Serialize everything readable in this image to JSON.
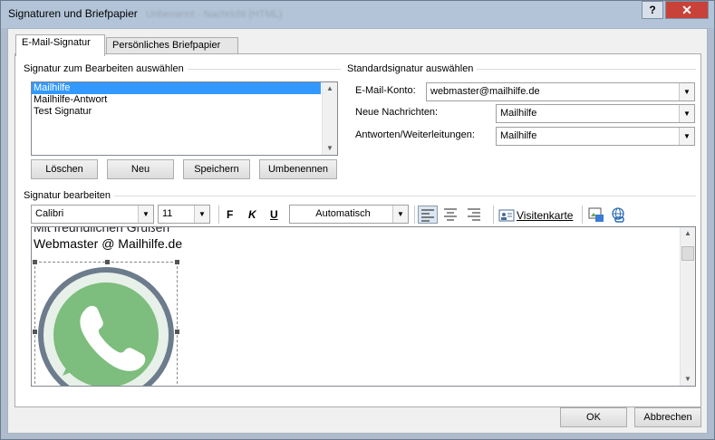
{
  "window": {
    "title": "Signaturen und Briefpapier",
    "ghost_title": "Unbenannt - Nachricht (HTML)",
    "help_label": "?",
    "close_label": "✕"
  },
  "tabs": [
    {
      "label": "E-Mail-Signatur"
    },
    {
      "label": "Persönliches Briefpapier"
    }
  ],
  "signature_select": {
    "group_label": "Signatur zum Bearbeiten auswählen",
    "items": [
      {
        "label": "Mailhilfe",
        "selected": true
      },
      {
        "label": "Mailhilfe-Antwort"
      },
      {
        "label": "Test Signatur"
      }
    ],
    "buttons": {
      "delete": "Löschen",
      "new": "Neu",
      "save": "Speichern",
      "rename": "Umbenennen"
    }
  },
  "default_signature": {
    "group_label": "Standardsignatur auswählen",
    "account_label": "E-Mail-Konto:",
    "account_value": "webmaster@mailhilfe.de",
    "new_messages_label": "Neue Nachrichten:",
    "new_messages_value": "Mailhilfe",
    "replies_label": "Antworten/Weiterleitungen:",
    "replies_value": "Mailhilfe"
  },
  "editor": {
    "group_label": "Signatur bearbeiten",
    "font": "Calibri",
    "size": "11",
    "bold": "F",
    "italic": "K",
    "underline": "U",
    "color": "Automatisch",
    "business_card": "Visitenkarte",
    "line1": "Mit freundlichen Grüßen",
    "line2": "Webmaster @ Mailhilfe.de",
    "image_icon": "whatsapp-logo-icon",
    "whatsapp_green": "#7dbd7d"
  },
  "footer": {
    "ok": "OK",
    "cancel": "Abbrechen"
  }
}
